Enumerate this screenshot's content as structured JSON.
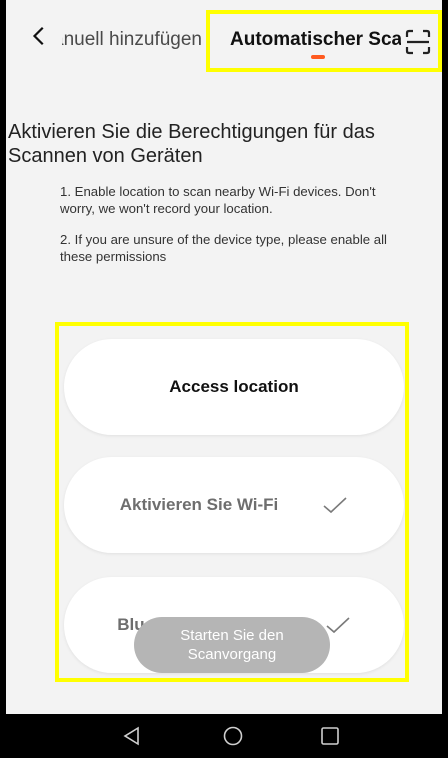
{
  "header": {
    "tab_left_label": "Manuell hinzufügen",
    "tab_active_label": "Automatischer Scan",
    "accent_color": "#ff5a1f"
  },
  "body": {
    "title": "Aktivieren Sie die Berechtigungen für das Scannen von Geräten",
    "hint1": "1. Enable location to scan nearby Wi-Fi devices. Don't worry, we won't record your location.",
    "hint2": "2. If you are unsure of the device type, please enable all these permissions"
  },
  "permissions": [
    {
      "label": "Access location",
      "checked": false
    },
    {
      "label": "Aktivieren Sie Wi-Fi",
      "checked": true
    },
    {
      "label": "Bluetooth aktivieren",
      "checked": true
    }
  ],
  "start_button": {
    "label": "Starten Sie den Scanvorgang"
  },
  "icons": {
    "back": "chevron-left-icon",
    "scan": "scan-frame-icon",
    "check": "check-icon",
    "nav_back": "triangle-back-icon",
    "nav_home": "circle-home-icon",
    "nav_recent": "square-recent-icon"
  }
}
